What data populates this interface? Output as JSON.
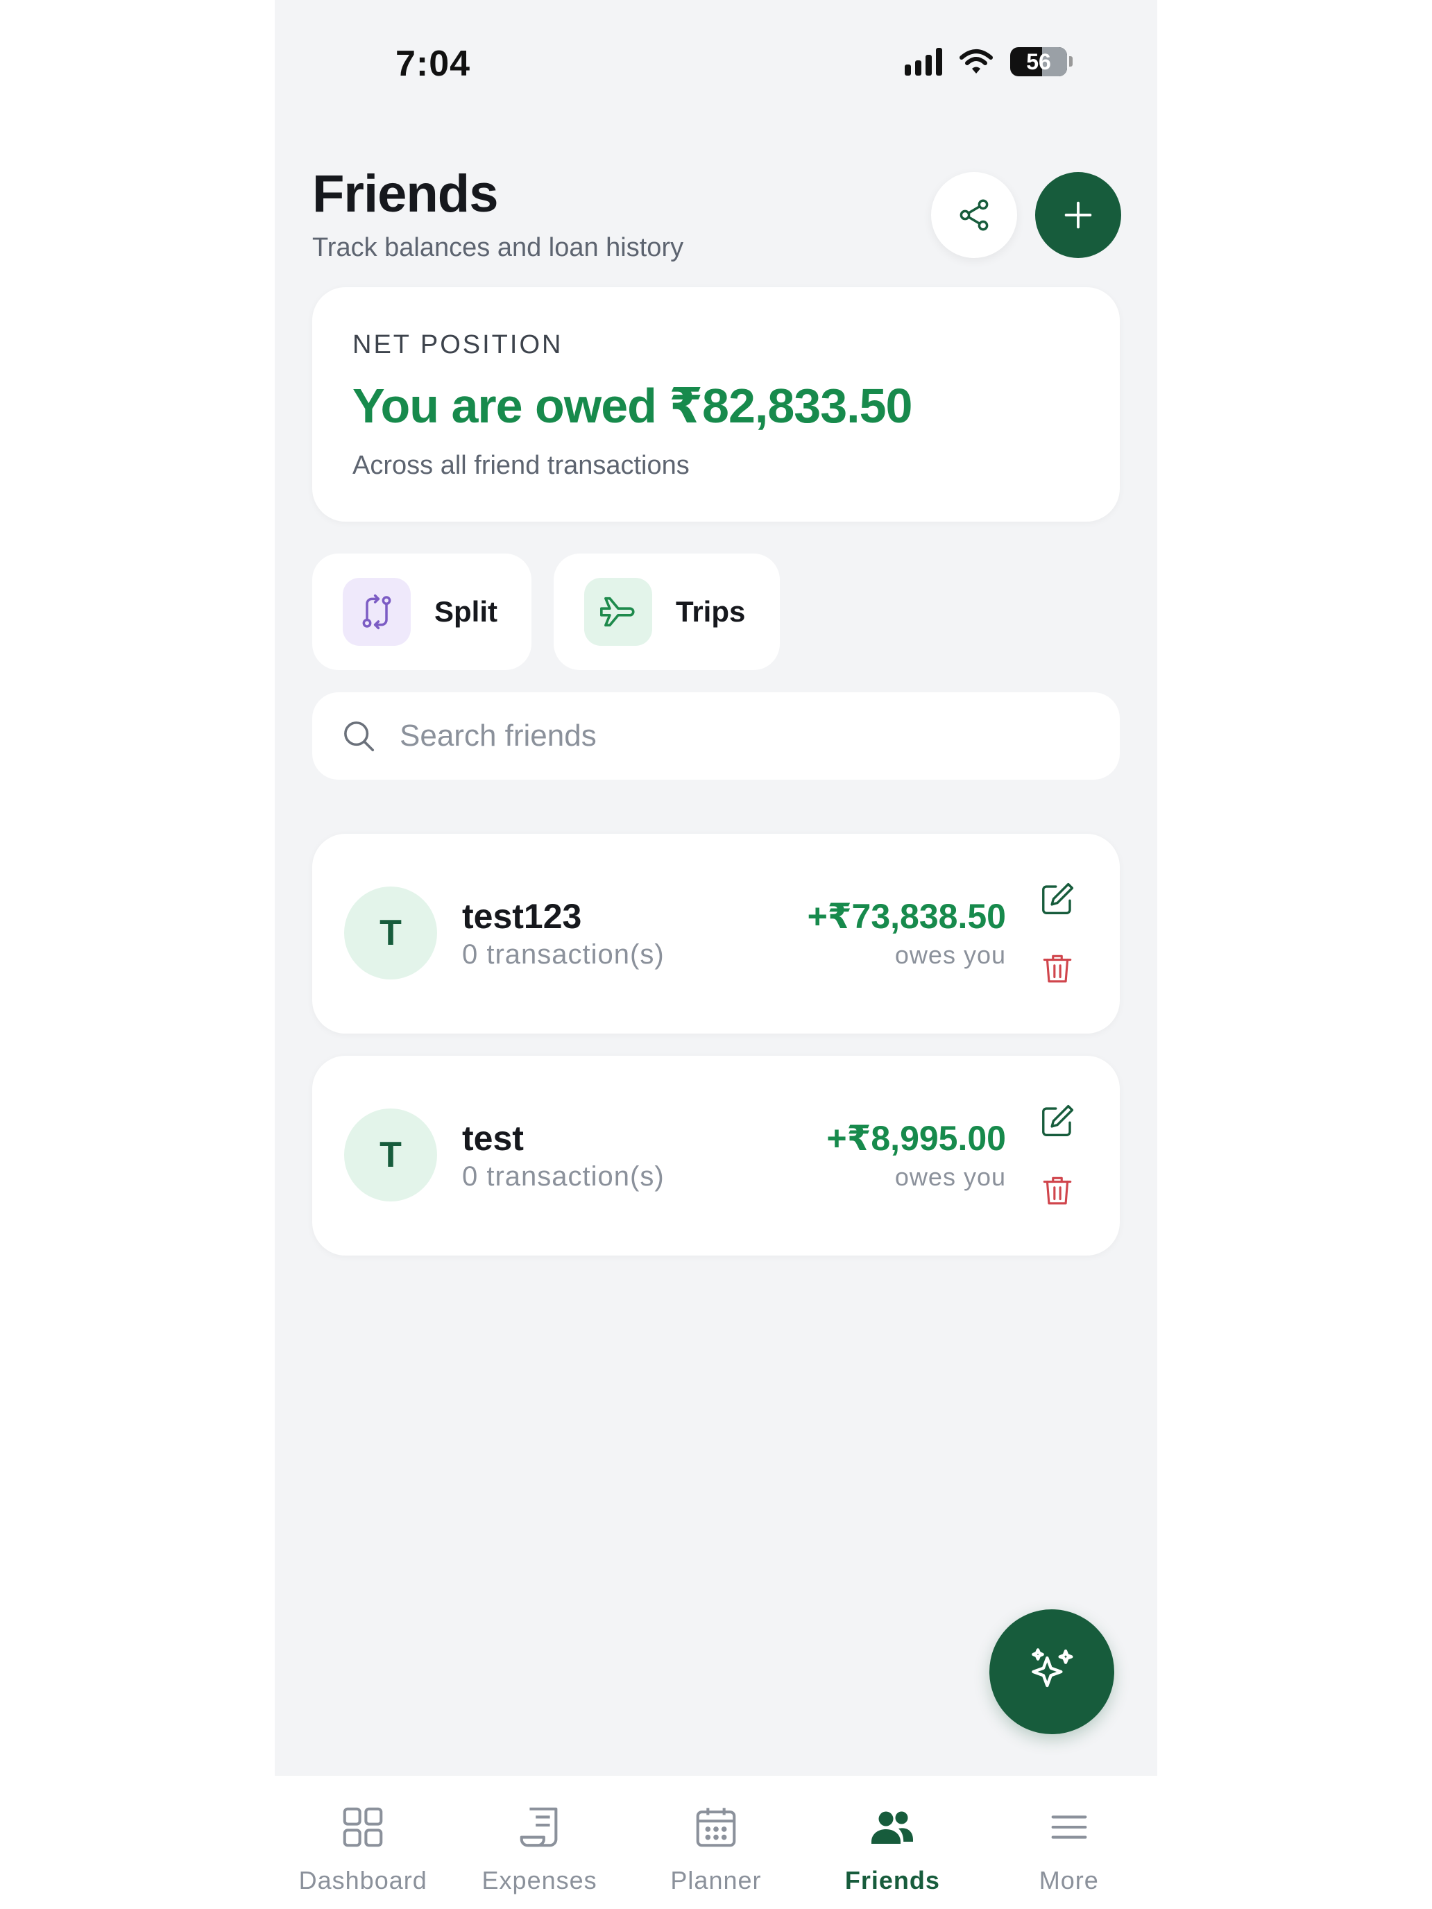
{
  "status_bar": {
    "time": "7:04",
    "battery": "56"
  },
  "header": {
    "title": "Friends",
    "subtitle": "Track balances and loan history"
  },
  "net_position": {
    "label": "NET POSITION",
    "amount": "You are owed ₹82,833.50",
    "description": "Across all friend transactions"
  },
  "quick_actions": [
    {
      "label": "Split"
    },
    {
      "label": "Trips"
    }
  ],
  "search": {
    "placeholder": "Search friends",
    "value": ""
  },
  "friends": [
    {
      "initial": "T",
      "name": "test123",
      "meta": "0 transaction(s)",
      "amount": "+₹73,838.50",
      "status": "owes you"
    },
    {
      "initial": "T",
      "name": "test",
      "meta": "0 transaction(s)",
      "amount": "+₹8,995.00",
      "status": "owes you"
    }
  ],
  "nav": [
    {
      "label": "Dashboard"
    },
    {
      "label": "Expenses"
    },
    {
      "label": "Planner"
    },
    {
      "label": "Friends"
    },
    {
      "label": "More"
    }
  ],
  "colors": {
    "primary": "#175c3c",
    "positive": "#178a4c",
    "danger": "#d0454c",
    "background": "#f3f4f6"
  }
}
